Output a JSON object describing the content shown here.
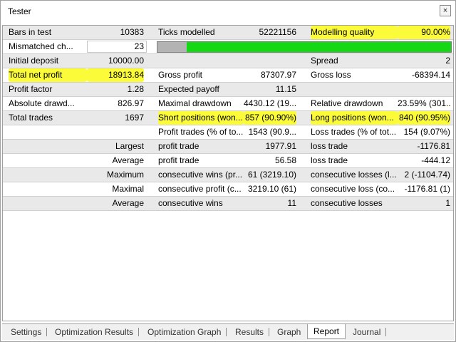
{
  "window": {
    "title": "Tester",
    "close_glyph": "×"
  },
  "report": {
    "row1": {
      "bars_label": "Bars in test",
      "bars_value": "10383",
      "ticks_label": "Ticks modelled",
      "ticks_value": "52221156",
      "quality_label": "Modelling quality",
      "quality_value": "90.00%"
    },
    "row2": {
      "mismatch_label": "Mismatched ch...",
      "mismatch_value": "23",
      "quality_bar_fraction": 0.9
    },
    "row3": {
      "deposit_label": "Initial deposit",
      "deposit_value": "10000.00",
      "spread_label": "Spread",
      "spread_value": "2"
    },
    "row4": {
      "net_label": "Total net profit",
      "net_value": "18913.84",
      "gross_profit_label": "Gross profit",
      "gross_profit_value": "87307.97",
      "gross_loss_label": "Gross loss",
      "gross_loss_value": "-68394.14"
    },
    "row5": {
      "pf_label": "Profit factor",
      "pf_value": "1.28",
      "payoff_label": "Expected payoff",
      "payoff_value": "11.15"
    },
    "row6": {
      "abs_dd_label": "Absolute drawd...",
      "abs_dd_value": "826.97",
      "max_dd_label": "Maximal drawdown",
      "max_dd_value": "4430.12 (19...",
      "rel_dd_label": "Relative drawdown",
      "rel_dd_value": "23.59% (301..."
    },
    "row7": {
      "trades_label": "Total trades",
      "trades_value": "1697",
      "short_label": "Short positions (won...",
      "short_value": "857 (90.90%)",
      "long_label": "Long positions (won...",
      "long_value": "840 (90.95%)"
    },
    "row8": {
      "pt_label": "Profit trades (% of to...",
      "pt_value": "1543 (90.9...",
      "lt_label": "Loss trades (% of tot...",
      "lt_value": "154 (9.07%)"
    },
    "row9": {
      "head": "Largest",
      "p_label": "profit trade",
      "p_value": "1977.91",
      "l_label": "loss trade",
      "l_value": "-1176.81"
    },
    "row10": {
      "head": "Average",
      "p_label": "profit trade",
      "p_value": "56.58",
      "l_label": "loss trade",
      "l_value": "-444.12"
    },
    "row11": {
      "head": "Maximum",
      "p_label": "consecutive wins (pr...",
      "p_value": "61 (3219.10)",
      "l_label": "consecutive losses (l...",
      "l_value": "2 (-1104.74)"
    },
    "row12": {
      "head": "Maximal",
      "p_label": "consecutive profit (c...",
      "p_value": "3219.10 (61)",
      "l_label": "consecutive loss (co...",
      "l_value": "-1176.81 (1)"
    },
    "row13": {
      "head": "Average",
      "p_label": "consecutive wins",
      "p_value": "11",
      "l_label": "consecutive losses",
      "l_value": "1"
    }
  },
  "tabs": [
    {
      "label": "Settings"
    },
    {
      "label": "Optimization Results"
    },
    {
      "label": "Optimization Graph"
    },
    {
      "label": "Results"
    },
    {
      "label": "Graph"
    },
    {
      "label": "Report"
    },
    {
      "label": "Journal"
    }
  ],
  "active_tab": "Report",
  "colors": {
    "highlight": "#fbfb3a",
    "bar_green": "#15d815",
    "bar_grey": "#b3b3b3",
    "row_shade": "#e9e9e9"
  }
}
